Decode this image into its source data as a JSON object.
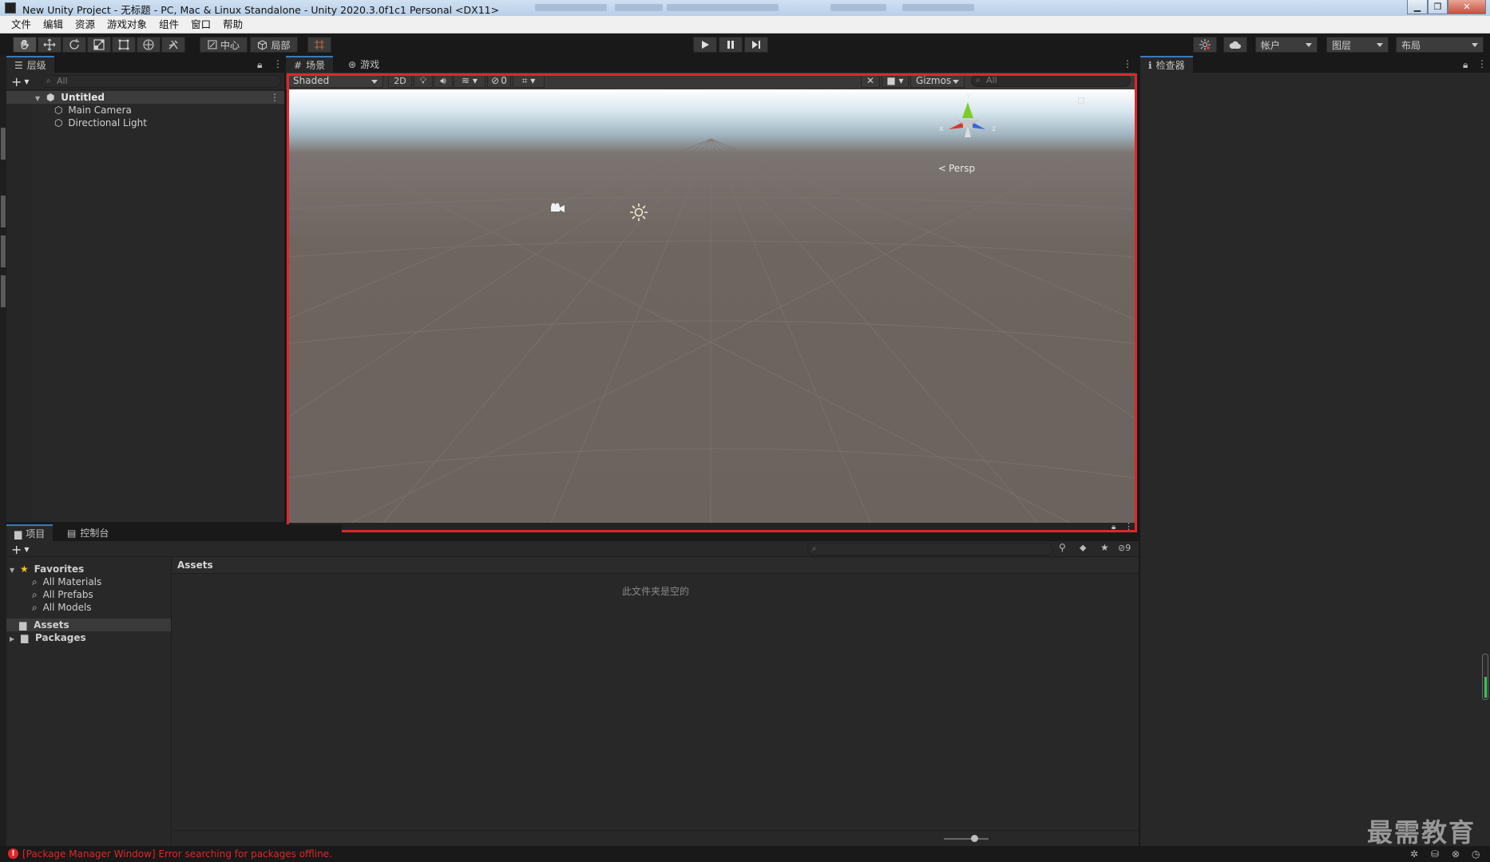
{
  "window": {
    "title": "New Unity Project - 无标题 - PC, Mac & Linux Standalone - Unity 2020.3.0f1c1 Personal <DX11>"
  },
  "menu": [
    "文件",
    "编辑",
    "资源",
    "游戏对象",
    "组件",
    "窗口",
    "帮助"
  ],
  "toolbar": {
    "pivot_label": "中心",
    "space_label": "局部",
    "account_label": "帐户",
    "layers_label": "图层",
    "layout_label": "布局"
  },
  "hierarchy": {
    "tab_label": "层级",
    "search_placeholder": "All",
    "scene_name": "Untitled",
    "objects": [
      "Main Camera",
      "Directional Light"
    ]
  },
  "scene": {
    "tabs": [
      "场景",
      "游戏"
    ],
    "draw_mode": "Shaded",
    "mode_2d": "2D",
    "hidden_count": "0",
    "gizmos_label": "Gizmos",
    "search_placeholder": "All",
    "axis_labels": {
      "x": "x",
      "y": "y",
      "z": "z"
    },
    "projection": "Persp"
  },
  "inspector": {
    "tab_label": "检查器"
  },
  "project": {
    "tabs": [
      "项目",
      "控制台"
    ],
    "favorites_label": "Favorites",
    "favorites": [
      "All Materials",
      "All Prefabs",
      "All Models"
    ],
    "folders": [
      "Assets",
      "Packages"
    ],
    "breadcrumb": "Assets",
    "empty_message": "此文件夹是空的",
    "hidden_packages_count": "9"
  },
  "status": {
    "error_message": "[Package Manager Window] Error searching for packages offline."
  },
  "watermark": "最需教育",
  "colors": {
    "accent": "#3a79bb",
    "highlight_frame": "#e0262a",
    "error": "#e0262a",
    "panel_bg": "#282828",
    "axis_x": "#d9362d",
    "axis_y": "#7ecb2e",
    "axis_z": "#3967d6"
  }
}
